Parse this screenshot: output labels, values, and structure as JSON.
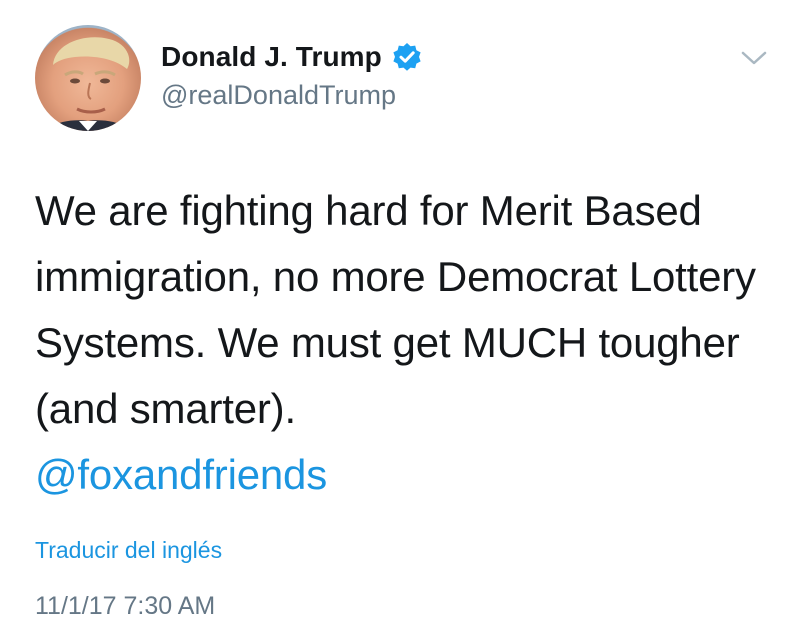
{
  "author": {
    "display_name": "Donald J. Trump",
    "handle": "@realDonaldTrump",
    "verified": true,
    "avatar_icon": "profile-photo",
    "verified_icon": "verified-badge-icon"
  },
  "tweet": {
    "text": "We are fighting hard for Merit Based immigration, no more Democrat Lottery Systems. We must get MUCH tougher (and smarter).",
    "mention": "@foxandfriends",
    "translate_label": "Traducir del inglés",
    "timestamp": "11/1/17 7:30 AM"
  },
  "menu": {
    "caret_icon": "chevron-down-icon"
  },
  "colors": {
    "text": "#14171a",
    "secondary": "#657786",
    "link": "#1b95e0",
    "verified": "#1da1f2"
  }
}
